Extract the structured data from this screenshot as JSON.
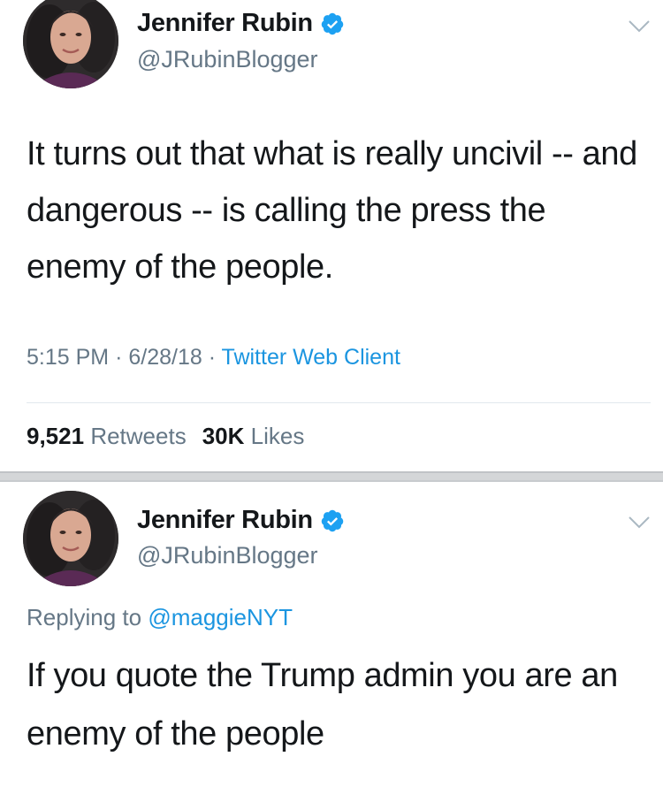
{
  "tweets": [
    {
      "author": {
        "name": "Jennifer Rubin",
        "handle": "@JRubinBlogger",
        "verified": true
      },
      "text": "It turns out that what is really uncivil -- and dangerous -- is calling the press the enemy of the people.",
      "time": "5:15 PM",
      "date": "6/28/18",
      "separator": "·",
      "source": "Twitter Web Client",
      "retweets_count": "9,521",
      "retweets_label": "Retweets",
      "likes_count": "30K",
      "likes_label": "Likes"
    },
    {
      "author": {
        "name": "Jennifer Rubin",
        "handle": "@JRubinBlogger",
        "verified": true
      },
      "replying_label": "Replying to",
      "replying_to": "@maggieNYT",
      "text": "If you quote the Trump admin you are an enemy of the people"
    }
  ],
  "colors": {
    "text": "#14171a",
    "secondary": "#657786",
    "link": "#1b95e0",
    "verified": "#1da1f2"
  },
  "icons": {
    "verified": "verified-badge-icon",
    "menu": "chevron-down-icon"
  }
}
